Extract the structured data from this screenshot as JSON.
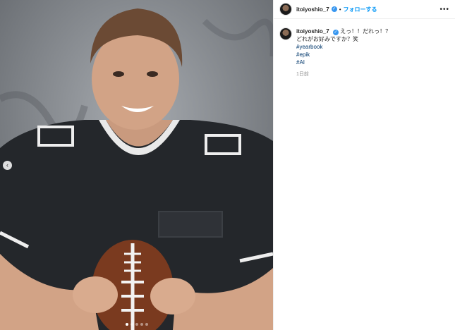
{
  "post": {
    "username": "itoiyoshio_7",
    "verified_symbol": "✓",
    "separator": "•",
    "follow_label": "フォローする",
    "more_icon": "•••",
    "prev_icon": "‹",
    "caption_lines": [
      "えっ！！だれっ！？",
      "どれがお好みですか？笑"
    ],
    "hashtags": [
      "#yearbook",
      "#epik",
      "#AI"
    ],
    "timestamp": "1日前",
    "carousel": {
      "slide_count": 5,
      "active_index": 0
    }
  },
  "colors": {
    "link": "#0095f6",
    "hashtag": "#00376b",
    "verified": "#3897f0"
  }
}
